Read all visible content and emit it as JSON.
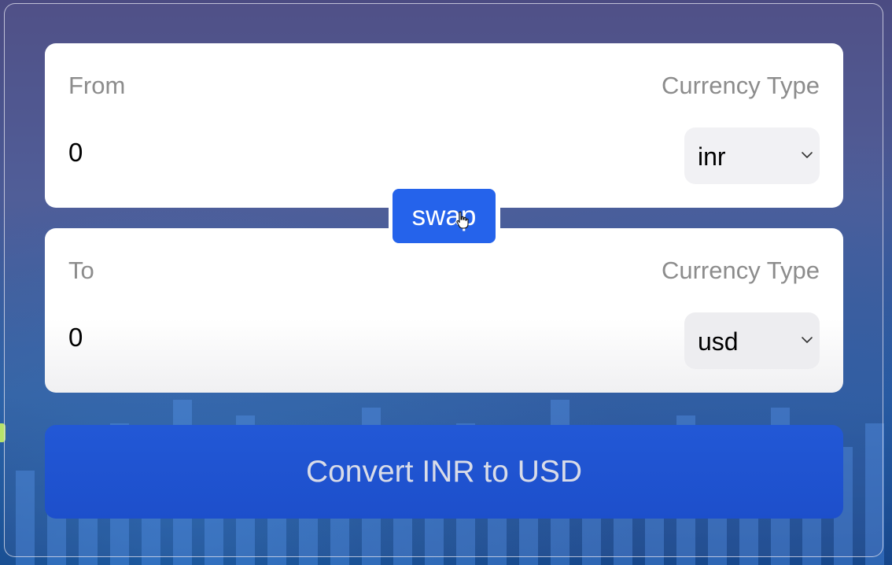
{
  "from_card": {
    "label": "From",
    "currency_label": "Currency Type",
    "amount_value": "0",
    "currency_selected": "inr"
  },
  "swap": {
    "label": "swap"
  },
  "to_card": {
    "label": "To",
    "currency_label": "Currency Type",
    "amount_value": "0",
    "currency_selected": "usd"
  },
  "convert": {
    "label": "Convert INR to USD"
  },
  "colors": {
    "accent": "#2563eb",
    "convert_button": "#1d4fcb",
    "label_gray": "#8c8c8c",
    "select_bg": "#f1f1f4"
  }
}
